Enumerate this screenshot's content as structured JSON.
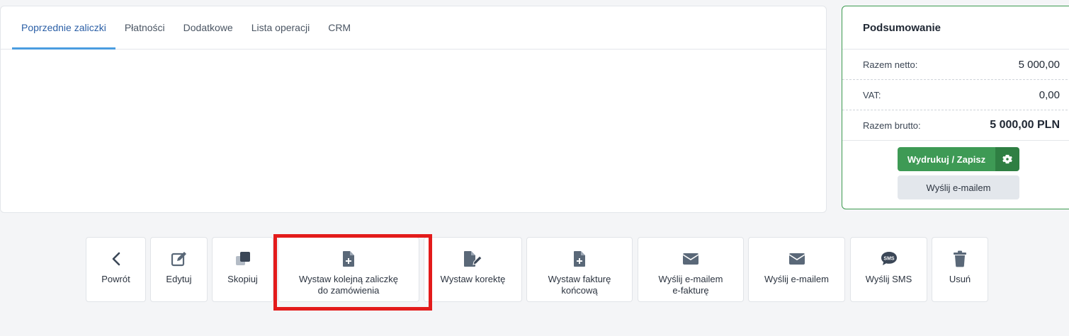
{
  "tabs": [
    {
      "label": "Poprzednie zaliczki",
      "active": true
    },
    {
      "label": "Płatności",
      "active": false
    },
    {
      "label": "Dodatkowe",
      "active": false
    },
    {
      "label": "Lista operacji",
      "active": false
    },
    {
      "label": "CRM",
      "active": false
    }
  ],
  "summary": {
    "title": "Podsumowanie",
    "net_label": "Razem netto:",
    "net_value": "5 000,00",
    "vat_label": "VAT:",
    "vat_value": "0,00",
    "gross_label": "Razem brutto:",
    "gross_value": "5 000,00 PLN",
    "print_button": "Wydrukuj / Zapisz",
    "settings_icon": "gear-icon",
    "email_button": "Wyślij e-mailem"
  },
  "actions": [
    {
      "label": "Powrót",
      "icon": "chevron-left-icon"
    },
    {
      "label": "Edytuj",
      "icon": "edit-icon"
    },
    {
      "label": "Skopiuj",
      "icon": "copy-icon"
    },
    {
      "label": "Wystaw kolejną zaliczkę\ndo zamówienia",
      "icon": "file-plus-icon"
    },
    {
      "label": "Wystaw korektę",
      "icon": "file-edit-icon"
    },
    {
      "label": "Wystaw fakturę\nkońcową",
      "icon": "file-plus-icon"
    },
    {
      "label": "Wyślij e-mailem\ne-fakturę",
      "icon": "envelope-icon"
    },
    {
      "label": "Wyślij e-mailem",
      "icon": "envelope-icon"
    },
    {
      "label": "Wyślij SMS",
      "icon": "sms-icon",
      "icon_text": "SMS"
    },
    {
      "label": "Usuń",
      "icon": "trash-icon"
    }
  ],
  "colors": {
    "accent": "#4a9de0",
    "primary_green": "#3e9a55",
    "highlight_red": "#e31b1b",
    "icon_gray": "#5a6878"
  }
}
